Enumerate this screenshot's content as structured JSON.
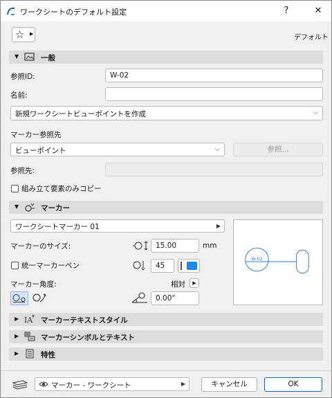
{
  "window": {
    "title": "ワークシートのデフォルト設定",
    "help": "?",
    "close": "✕"
  },
  "toolbar": {
    "star": "☆",
    "default_label": "デフォルト"
  },
  "general": {
    "section_label": "一般",
    "ref_id_label": "参照ID:",
    "ref_id_value": "W-02",
    "name_label": "名前:",
    "name_value": "",
    "viewpoint_mode": "新規ワークシートビューポイントを作成",
    "marker_ref_label": "マーカー参照先",
    "marker_ref_value": "ビューポイント",
    "browse_label": "参照...",
    "ref_to_label": "参照先:",
    "ref_to_value": "",
    "copy_assembly_label": "組み立て要素のみコピー"
  },
  "marker": {
    "section_label": "マーカー",
    "marker_type": "ワークシートマーカー 01",
    "size_label": "マーカーのサイズ:",
    "size_value": "15.00",
    "size_unit": "mm",
    "uniform_pen_label": "統一マーカーペン",
    "pen_value": "45",
    "pen_color": "#1e88e5",
    "angle_label": "マーカー角度:",
    "relative_label": "相対",
    "angle_value": "0.00°",
    "preview_text": "W-02",
    "preview_color": "#3a7bd5"
  },
  "collapsed_sections": [
    {
      "label": "マーカーテキストスタイル"
    },
    {
      "label": "マーカーシンボルとテキスト"
    },
    {
      "label": "特性"
    }
  ],
  "footer": {
    "layer_label": "マーカー - ワークシート",
    "cancel_label": "キャンセル",
    "ok_label": "OK"
  }
}
